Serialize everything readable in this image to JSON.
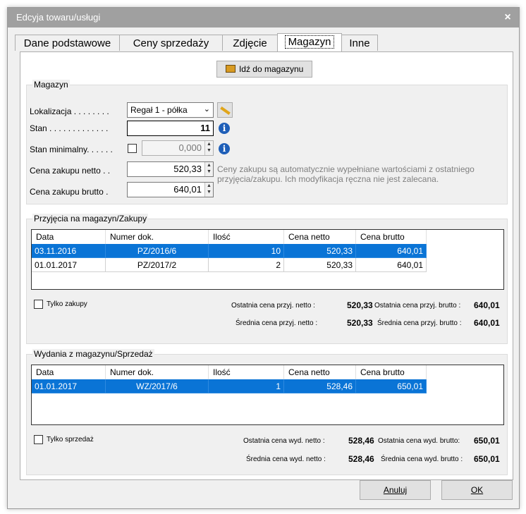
{
  "window": {
    "title": "Edcyja towaru/usługi",
    "close_glyph": "×"
  },
  "tabs": [
    {
      "label": "Dane podstawowe"
    },
    {
      "label": "Ceny sprzedaży"
    },
    {
      "label": "Zdjęcie"
    },
    {
      "label": "Magazyn"
    },
    {
      "label": "Inne"
    }
  ],
  "goto_button": {
    "label": "Idź do magazynu",
    "icon": "forklift-icon"
  },
  "magazyn": {
    "title": "Magazyn",
    "lokalizacja_label": "Lokalizacja . . . . . . . .",
    "lokalizacja_value": "Regał 1 - półka",
    "stan_label": "Stan . . . . . . . . . . . . .",
    "stan_value": "11",
    "stan_min_label": "Stan minimalny. . . . . .",
    "stan_min_value": "0,000",
    "cena_netto_label": "Cena zakupu netto . .",
    "cena_netto_value": "520,33",
    "cena_brutto_label": "Cena zakupu brutto .",
    "cena_brutto_value": "640,01",
    "info_text": "Ceny zakupu są automatycznie wypełniane wartościami z ostatniego przyjęcia/zakupu. Ich modyfikacja ręczna nie jest zalecana."
  },
  "przyjecia": {
    "title": "Przyjęcia na magazyn/Zakupy",
    "columns": [
      "Data",
      "Numer dok.",
      "Ilość",
      "Cena netto",
      "Cena brutto"
    ],
    "rows": [
      {
        "data": "03.11.2016",
        "numer": "PZ/2016/6",
        "ilosc": "10",
        "netto": "520,33",
        "brutto": "640,01"
      },
      {
        "data": "01.01.2017",
        "numer": "PZ/2017/2",
        "ilosc": "2",
        "netto": "520,33",
        "brutto": "640,01"
      }
    ],
    "filter_label": "Tylko zakupy",
    "ost_netto_label": "Ostatnia cena przyj. netto :",
    "ost_netto_value": "520,33",
    "ost_brutto_label": "Ostatnia cena przyj. brutto :",
    "ost_brutto_value": "640,01",
    "sr_netto_label": "Średnia cena przyj. netto :",
    "sr_netto_value": "520,33",
    "sr_brutto_label": "Średnia cena przyj. brutto :",
    "sr_brutto_value": "640,01"
  },
  "wydania": {
    "title": "Wydania z magazynu/Sprzedaż",
    "columns": [
      "Data",
      "Numer dok.",
      "Ilość",
      "Cena netto",
      "Cena brutto"
    ],
    "rows": [
      {
        "data": "01.01.2017",
        "numer": "WZ/2017/6",
        "ilosc": "1",
        "netto": "528,46",
        "brutto": "650,01"
      }
    ],
    "filter_label": "Tylko sprzedaż",
    "ost_netto_label": "Ostatnia cena wyd. netto :",
    "ost_netto_value": "528,46",
    "ost_brutto_label": "Ostatnia cena wyd. brutto:",
    "ost_brutto_value": "650,01",
    "sr_netto_label": "Średnia cena wyd. netto :",
    "sr_netto_value": "528,46",
    "sr_brutto_label": "Średnia cena wyd. brutto :",
    "sr_brutto_value": "650,01"
  },
  "footer": {
    "cancel_label": "Anuluj",
    "ok_label": "OK"
  }
}
